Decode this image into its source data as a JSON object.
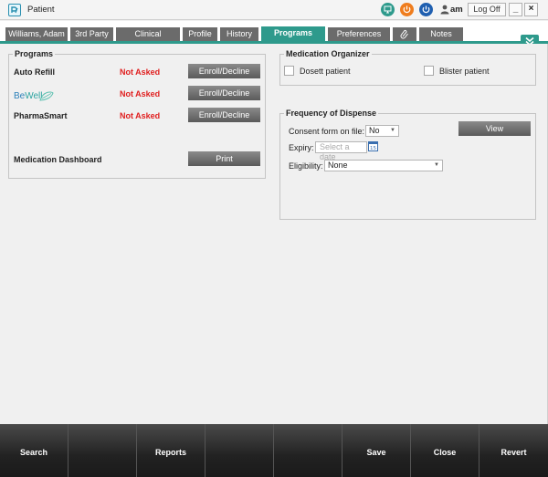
{
  "window": {
    "title": "Patient",
    "user": "am",
    "logoff_label": "Log Off",
    "minimize_label": "_",
    "close_label": "×"
  },
  "tabs": [
    {
      "label": "Williams, Adam"
    },
    {
      "label": "3rd Party"
    },
    {
      "label": "Clinical"
    },
    {
      "label": "Profile"
    },
    {
      "label": "History"
    },
    {
      "label": "Programs",
      "active": true
    },
    {
      "label": "Preferences"
    },
    {
      "label": "",
      "icon": "paperclip-icon"
    },
    {
      "label": "Notes"
    }
  ],
  "programs": {
    "title": "Programs",
    "items": [
      {
        "name": "Auto Refill",
        "status": "Not Asked",
        "button": "Enroll/Decline"
      },
      {
        "name": "BeWell",
        "status": "Not Asked",
        "button": "Enroll/Decline"
      },
      {
        "name": "PharmaSmart",
        "status": "Not Asked",
        "button": "Enroll/Decline"
      }
    ],
    "dashboard_label": "Medication Dashboard",
    "print_label": "Print",
    "bewell_logo": {
      "be": "Be",
      "well": "Well"
    }
  },
  "organizer": {
    "title": "Medication Organizer",
    "dosett_label": "Dosett patient",
    "blister_label": "Blister patient"
  },
  "frequency": {
    "title": "Frequency of Dispense",
    "consent_label": "Consent form on file:",
    "consent_value": "No",
    "expiry_label": "Expiry:",
    "expiry_placeholder": "Select a date",
    "calendar_day": "15",
    "eligibility_label": "Eligibility:",
    "eligibility_value": "None",
    "view_label": "View"
  },
  "bottom": {
    "search": "Search",
    "reports": "Reports",
    "save": "Save",
    "close": "Close",
    "revert": "Revert"
  },
  "colors": {
    "accent": "#2e9a8c",
    "tab_inactive": "#6b6b6b",
    "status_red": "#e02020"
  }
}
